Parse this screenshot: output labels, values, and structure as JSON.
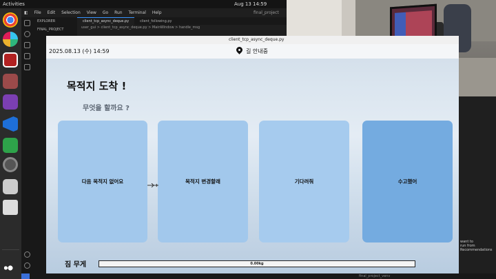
{
  "topbar": {
    "activities": "Activities",
    "clock": "Aug 13  14:59"
  },
  "vscode": {
    "menu": [
      "File",
      "Edit",
      "Selection",
      "View",
      "Go",
      "Run",
      "Terminal",
      "Help"
    ],
    "window_title": "final_project",
    "explorer_label": "EXPLORER",
    "project_label": "FINAL_PROJECT",
    "tabs": [
      "client_tcp_async_deque.py",
      "client_following.py"
    ],
    "breadcrumb": "user_gui > client_tcp_async_deque.py > MainWindow > handle_msg",
    "status": "final_project_venv"
  },
  "terminal_note": [
    "want to",
    "run from",
    "Recommendations"
  ],
  "app": {
    "window_title": "client_tcp_async_deque.py",
    "datetime": "2025.08.13 (수) 14:59",
    "guide_status": "길 안내중",
    "arrival_title": "목적지 도착 !",
    "question": "무엇을 할까요 ?",
    "choices": [
      "다음 목적지 없어요",
      "목적지 변경할래",
      "기다려줘",
      "수고했어"
    ],
    "weight_label": "짐 무게",
    "weight_value": "0.00kg"
  },
  "colors": {
    "choice": "#a2c8ec",
    "choice_selected": "#74abe0",
    "accent": "#3794ff"
  }
}
